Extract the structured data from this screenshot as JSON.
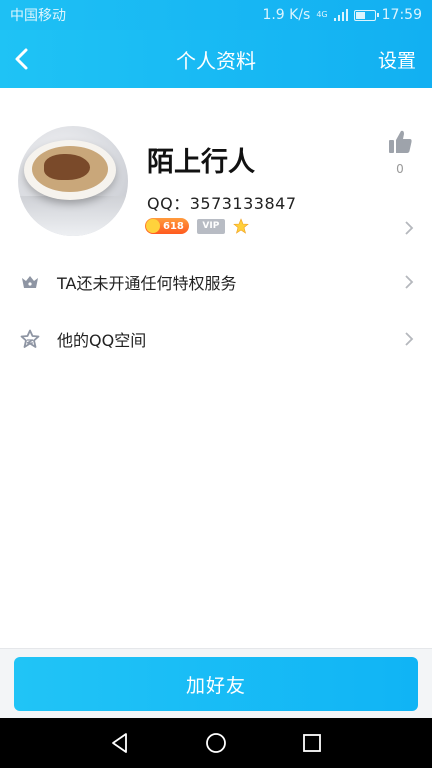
{
  "status_bar": {
    "carrier": "中国移动",
    "network_speed": "1.9 K/s",
    "network_type": "4G",
    "time": "17:59",
    "battery_level": 0.45
  },
  "nav": {
    "title": "个人资料",
    "settings_label": "设置",
    "back_icon": "chevron-left-icon"
  },
  "profile": {
    "nickname": "陌上行人",
    "qq_label": "QQ：",
    "qq_number": "3573133847",
    "level_badge": "618",
    "vip_label": "VIP",
    "like_count": "0"
  },
  "rows": [
    {
      "label": "TA还未开通任何特权服务",
      "icon": "crown-icon"
    },
    {
      "label": "他的QQ空间",
      "icon": "star-icon"
    }
  ],
  "actions": {
    "add_friend_label": "加好友"
  },
  "colors": {
    "brand_blue": "#12b0f2",
    "button_blue": "#21c4f6",
    "background": "#ffffff"
  }
}
